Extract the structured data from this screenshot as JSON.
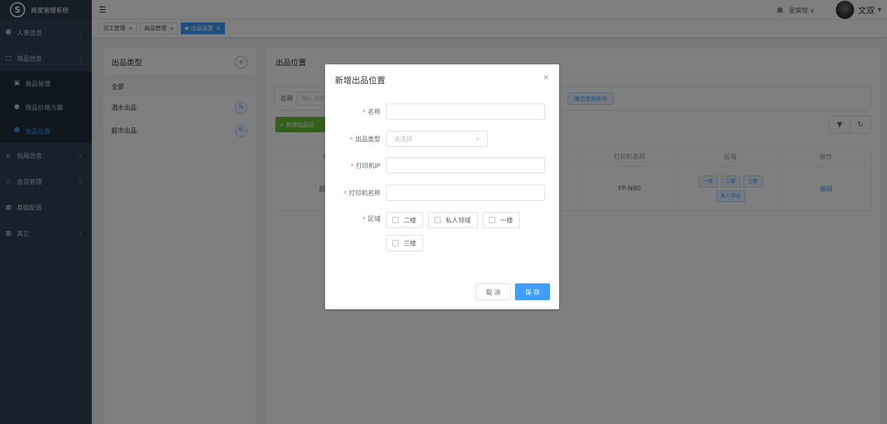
{
  "app": {
    "title": "商家管理系统"
  },
  "sidebar": {
    "items": [
      {
        "label": "人事信息",
        "icon": "person-icon"
      },
      {
        "label": "商品信息",
        "icon": "goods-icon"
      },
      {
        "label": "包厢信息",
        "icon": "home-icon"
      },
      {
        "label": "会员管理",
        "icon": "member-icon"
      },
      {
        "label": "基础配置",
        "icon": "grid-icon"
      },
      {
        "label": "其它",
        "icon": "grid-icon"
      }
    ],
    "submenu": [
      {
        "label": "商品管理"
      },
      {
        "label": "商品价格方案"
      },
      {
        "label": "出品设置"
      }
    ]
  },
  "header": {
    "store": "星宸悦",
    "user": "文双"
  },
  "tags": [
    {
      "label": "员工管理"
    },
    {
      "label": "商品管理"
    },
    {
      "label": "出品设置"
    }
  ],
  "left_panel": {
    "title": "出品类型",
    "items": [
      {
        "label": "全部"
      },
      {
        "label": "酒水出品"
      },
      {
        "label": "超市出品"
      }
    ]
  },
  "right_panel": {
    "title": "出品位置",
    "search_label": "名称",
    "search_placeholder": "输入关键",
    "clear_button": "清空查询条件",
    "add_button": "新增出品位",
    "columns": [
      "名",
      "打印机名称",
      "区域",
      "操作"
    ],
    "row": {
      "name": "超市"
    },
    "printer": "FP-N80",
    "zones": [
      "一楼",
      "二楼",
      "三楼",
      "私人领域"
    ],
    "edit": "编辑"
  },
  "dialog": {
    "title": "新增出品位置",
    "required_mark": "*",
    "fields": {
      "name": {
        "label": "名称"
      },
      "type": {
        "label": "出品类型",
        "placeholder": "请选择"
      },
      "ip": {
        "label": "打印机IP"
      },
      "printer_name": {
        "label": "打印机名称"
      },
      "zone": {
        "label": "区域"
      }
    },
    "zone_options": [
      "二楼",
      "私人领域",
      "一楼",
      "三楼"
    ],
    "cancel": "取 消",
    "save": "保 存"
  }
}
